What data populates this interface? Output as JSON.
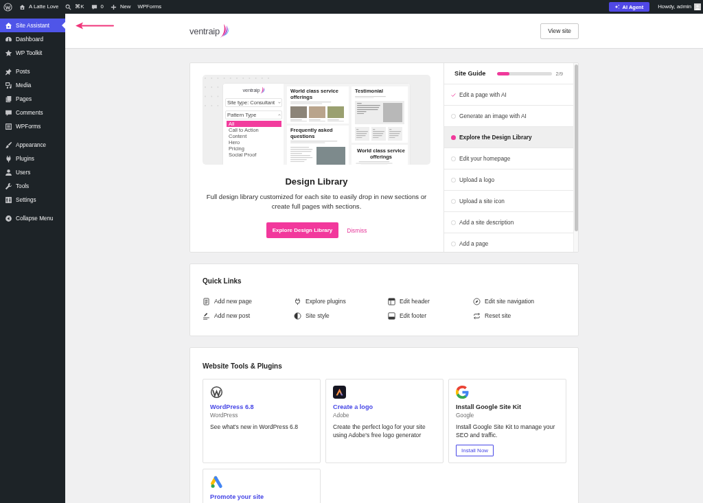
{
  "admin_bar": {
    "site_name": "A Latte Love",
    "search_shortcut": "⌘K",
    "comment_count": "0",
    "new_label": "New",
    "plugin_link": "WPForms",
    "ai_button": "AI Agent",
    "greeting": "Howdy, admin"
  },
  "sidebar": {
    "groups": [
      [
        {
          "label": "Site Assistant",
          "selected": true
        },
        {
          "label": "Dashboard",
          "selected": false
        },
        {
          "label": "WP Toolkit",
          "selected": false
        }
      ],
      [
        {
          "label": "Posts",
          "selected": false
        },
        {
          "label": "Media",
          "selected": false
        },
        {
          "label": "Pages",
          "selected": false
        },
        {
          "label": "Comments",
          "selected": false
        },
        {
          "label": "WPForms",
          "selected": false
        }
      ],
      [
        {
          "label": "Appearance",
          "selected": false
        },
        {
          "label": "Plugins",
          "selected": false
        },
        {
          "label": "Users",
          "selected": false
        },
        {
          "label": "Tools",
          "selected": false
        },
        {
          "label": "Settings",
          "selected": false
        }
      ]
    ],
    "collapse": "Collapse Menu"
  },
  "annotations": [
    {
      "kind": "arrow"
    }
  ],
  "header": {
    "logo": "ventraip",
    "button": "View site"
  },
  "design_library": {
    "preview": {
      "logo": "ventraip",
      "site_type": "Site type: Consultant",
      "filter_title": "Pattern Type",
      "filters": [
        {
          "label": "All",
          "selected": true
        },
        {
          "label": "Call to Action",
          "selected": false
        },
        {
          "label": "Content",
          "selected": false
        },
        {
          "label": "Hero",
          "selected": false
        },
        {
          "label": "Pricing",
          "selected": false
        },
        {
          "label": "Social Proof",
          "selected": false
        }
      ],
      "columns": [
        [
          {
            "kind": "services",
            "title": "World class service offerings"
          },
          {
            "kind": "faq",
            "title": "Frequently asked questions"
          }
        ],
        [
          {
            "kind": "testimonial",
            "title": "Testimonial"
          },
          {
            "kind": "offer",
            "title": "World class service offerings"
          }
        ]
      ]
    },
    "title": "Design Library",
    "description": "Full design library customized for each site to easily drop in new sections or create full pages with sections.",
    "button": "Explore Design Library",
    "dismiss": "Dismiss"
  },
  "site_guide": {
    "title": "Site Guide",
    "level": 0.22,
    "count": "2/9",
    "items": [
      {
        "label": "Edit a page with AI",
        "done": true,
        "selected": false
      },
      {
        "label": "Generate an image with AI",
        "done": false,
        "selected": false
      },
      {
        "label": "Explore the Design Library",
        "done": false,
        "selected": true
      },
      {
        "label": "Edit your homepage",
        "done": false,
        "selected": false
      },
      {
        "label": "Upload a logo",
        "done": false,
        "selected": false
      },
      {
        "label": "Upload a site icon",
        "done": false,
        "selected": false
      },
      {
        "label": "Add a site description",
        "done": false,
        "selected": false
      },
      {
        "label": "Add a page",
        "done": false,
        "selected": false
      }
    ]
  },
  "quick_links": {
    "title": "Quick Links",
    "items": [
      "Add new page",
      "Explore plugins",
      "Edit header",
      "Edit site navigation",
      "Add new post",
      "Site style",
      "Edit footer",
      "Reset site"
    ]
  },
  "tools": {
    "title": "Website Tools & Plugins",
    "cards": [
      {
        "kind": "link",
        "title": "WordPress 6.8",
        "vendor": "WordPress",
        "description": "See what's new in WordPress 6.8"
      },
      {
        "kind": "link",
        "title": "Create a logo",
        "vendor": "Adobe",
        "description": "Create the perfect logo for your site using Adobe's free logo generator"
      },
      {
        "kind": "install",
        "title": "Install Google Site Kit",
        "vendor": "Google",
        "description": "Install Google Site Kit to manage your SEO and traffic.",
        "button": "Install Now"
      },
      {
        "kind": "link",
        "title": "Promote your site"
      }
    ]
  }
}
